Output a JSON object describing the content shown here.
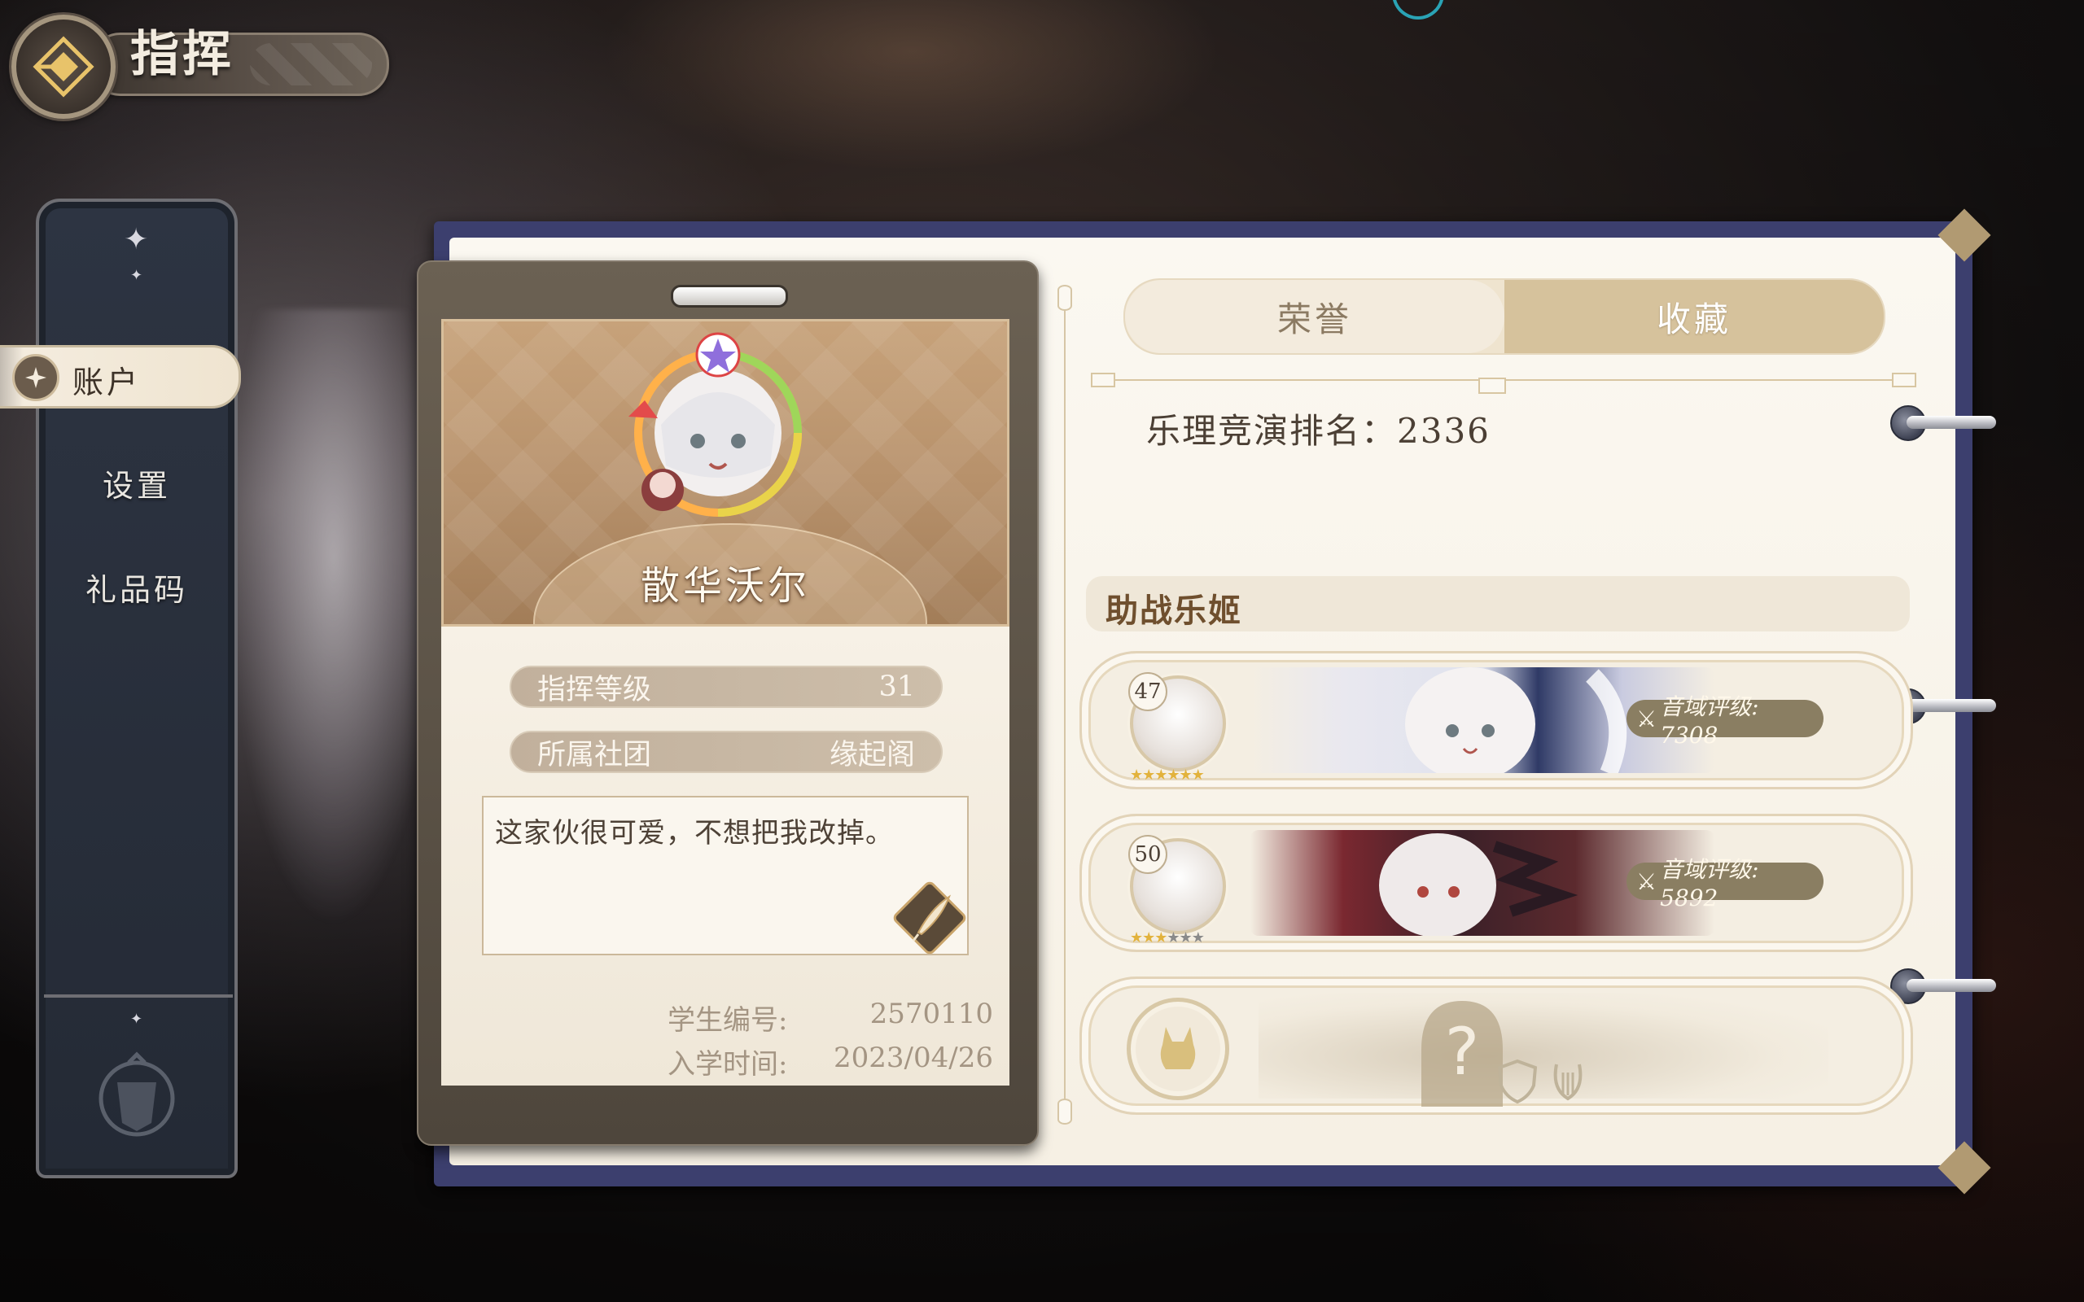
{
  "header": {
    "title": "指挥"
  },
  "menu": {
    "items": [
      {
        "label": "账户",
        "active": true
      },
      {
        "label": "设置",
        "active": false
      },
      {
        "label": "礼品码",
        "active": false
      }
    ]
  },
  "profile": {
    "name": "散华沃尔",
    "stats": [
      {
        "label": "指挥等级",
        "value": "31"
      },
      {
        "label": "所属社团",
        "value": "缘起阁"
      }
    ],
    "motto": "这家伙很可爱，不想把我改掉。",
    "student_id_label": "学生编号:",
    "student_id": "2570110",
    "enroll_label": "入学时间:",
    "enroll_date": "2023/04/26"
  },
  "tabs": [
    {
      "label": "荣誉",
      "selected": false
    },
    {
      "label": "收藏",
      "selected": true
    }
  ],
  "rank": {
    "text": "乐理竞演排名：2336"
  },
  "support_section": {
    "title": "助战乐姬",
    "entries": [
      {
        "level": "47",
        "stars_filled": 6,
        "stars_total": 6,
        "rating": "音域评级: 7308"
      },
      {
        "level": "50",
        "stars_filled": 3,
        "stars_total": 6,
        "rating": "音域评级: 5892"
      },
      {
        "locked": true,
        "placeholder": "?"
      }
    ]
  },
  "colors": {
    "accent_gold": "#d6c29c",
    "book_cover": "#3c3f6e",
    "rating_pill": "#8a7e62",
    "title_brown": "#6f4f2e"
  }
}
